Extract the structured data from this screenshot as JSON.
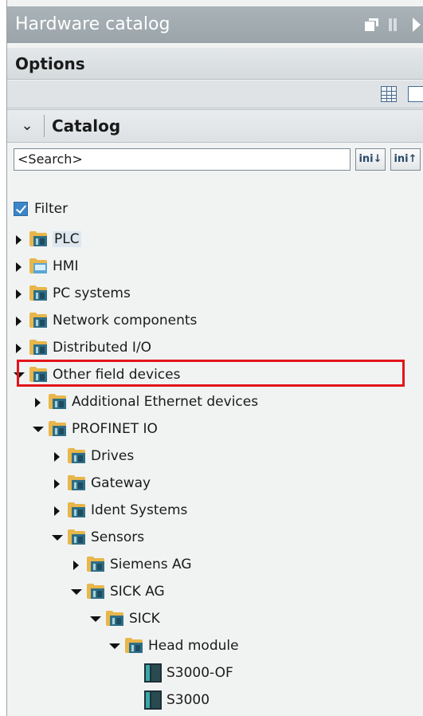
{
  "panel": {
    "title": "Hardware catalog",
    "options_label": "Options"
  },
  "catalog": {
    "header_label": "Catalog",
    "search_placeholder": "<Search>",
    "search_down_label": "ini↓",
    "search_up_label": "ini↑",
    "filter_label": "Filter",
    "filter_checked": true
  },
  "tree": [
    {
      "label": "PLC",
      "state": "closed",
      "icon": "folder-icon",
      "level": 0
    },
    {
      "label": "HMI",
      "state": "closed",
      "icon": "hmi-folder-icon",
      "level": 0
    },
    {
      "label": "PC systems",
      "state": "closed",
      "icon": "folder-icon",
      "level": 0
    },
    {
      "label": "Network components",
      "state": "closed",
      "icon": "folder-icon",
      "level": 0
    },
    {
      "label": "Distributed I/O",
      "state": "closed",
      "icon": "folder-icon",
      "level": 0
    },
    {
      "label": "Other field devices",
      "state": "open",
      "icon": "folder-icon",
      "level": 0
    },
    {
      "label": "Additional Ethernet devices",
      "state": "closed",
      "icon": "folder-icon",
      "level": 1
    },
    {
      "label": "PROFINET IO",
      "state": "open",
      "icon": "folder-icon",
      "level": 1
    },
    {
      "label": "Drives",
      "state": "closed",
      "icon": "folder-icon",
      "level": 2
    },
    {
      "label": "Gateway",
      "state": "closed",
      "icon": "folder-icon",
      "level": 2
    },
    {
      "label": "Ident Systems",
      "state": "closed",
      "icon": "folder-icon",
      "level": 2
    },
    {
      "label": "Sensors",
      "state": "open",
      "icon": "folder-icon",
      "level": 2
    },
    {
      "label": "Siemens AG",
      "state": "closed",
      "icon": "folder-icon",
      "level": 3
    },
    {
      "label": "SICK AG",
      "state": "open",
      "icon": "folder-icon",
      "level": 3
    },
    {
      "label": "SICK",
      "state": "open",
      "icon": "folder-icon",
      "level": 4
    },
    {
      "label": "Head module",
      "state": "open",
      "icon": "folder-icon",
      "level": 5
    },
    {
      "label": "S3000-OF",
      "state": "none",
      "icon": "device-icon",
      "level": 6
    },
    {
      "label": "S3000",
      "state": "none",
      "icon": "device-icon",
      "level": 6
    }
  ],
  "highlighted_item": "Other field devices",
  "colors": {
    "highlight_box": "#e3141b",
    "title_bar": "#a4aeb3",
    "folder": "#e8b64a"
  }
}
